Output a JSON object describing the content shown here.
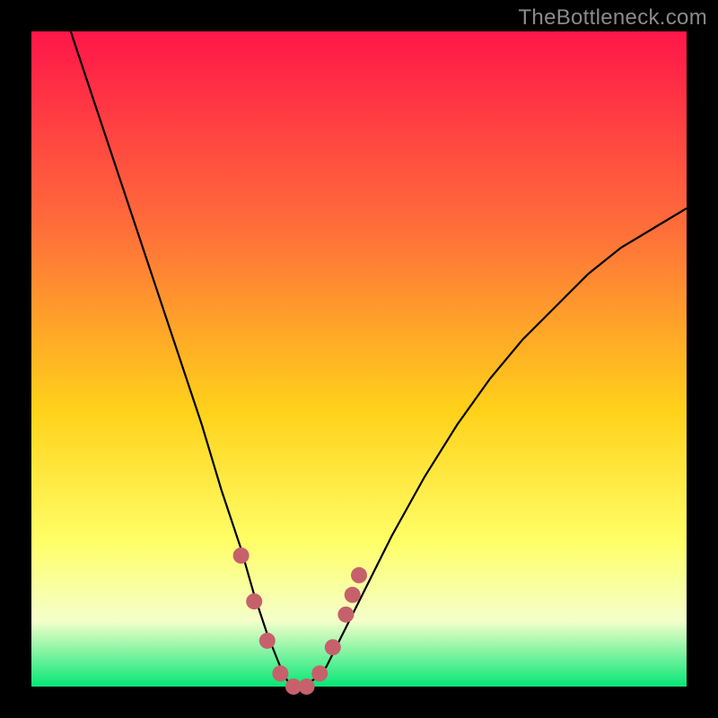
{
  "watermark": "TheBottleneck.com",
  "colors": {
    "frame": "#000000",
    "gradient_top": "#FF1649",
    "gradient_mid1": "#FF6E3A",
    "gradient_mid2": "#FFD21A",
    "gradient_mid3": "#FFFF68",
    "gradient_mid4": "#F4FFCB",
    "gradient_bottom": "#06E775",
    "curve": "#000000",
    "markers": "#C6616C"
  },
  "chart_data": {
    "type": "line",
    "title": "",
    "xlabel": "",
    "ylabel": "",
    "xlim": [
      0,
      100
    ],
    "ylim": [
      0,
      100
    ],
    "series": [
      {
        "name": "bottleneck-curve",
        "x": [
          6,
          10,
          14,
          18,
          22,
          26,
          29,
          32,
          34,
          36,
          38,
          39,
          40,
          41,
          43,
          45,
          47,
          50,
          55,
          60,
          65,
          70,
          75,
          80,
          85,
          90,
          95,
          100
        ],
        "y": [
          100,
          88,
          76,
          64,
          52,
          40,
          30,
          21,
          14,
          8,
          3,
          1,
          0,
          0,
          1,
          3,
          7,
          13,
          23,
          32,
          40,
          47,
          53,
          58,
          63,
          67,
          70,
          73
        ]
      }
    ],
    "markers": {
      "name": "highlight-points",
      "x": [
        32,
        34,
        36,
        38,
        40,
        42,
        44,
        46,
        48,
        49,
        50
      ],
      "y": [
        20,
        13,
        7,
        2,
        0,
        0,
        2,
        6,
        11,
        14,
        17
      ]
    }
  }
}
